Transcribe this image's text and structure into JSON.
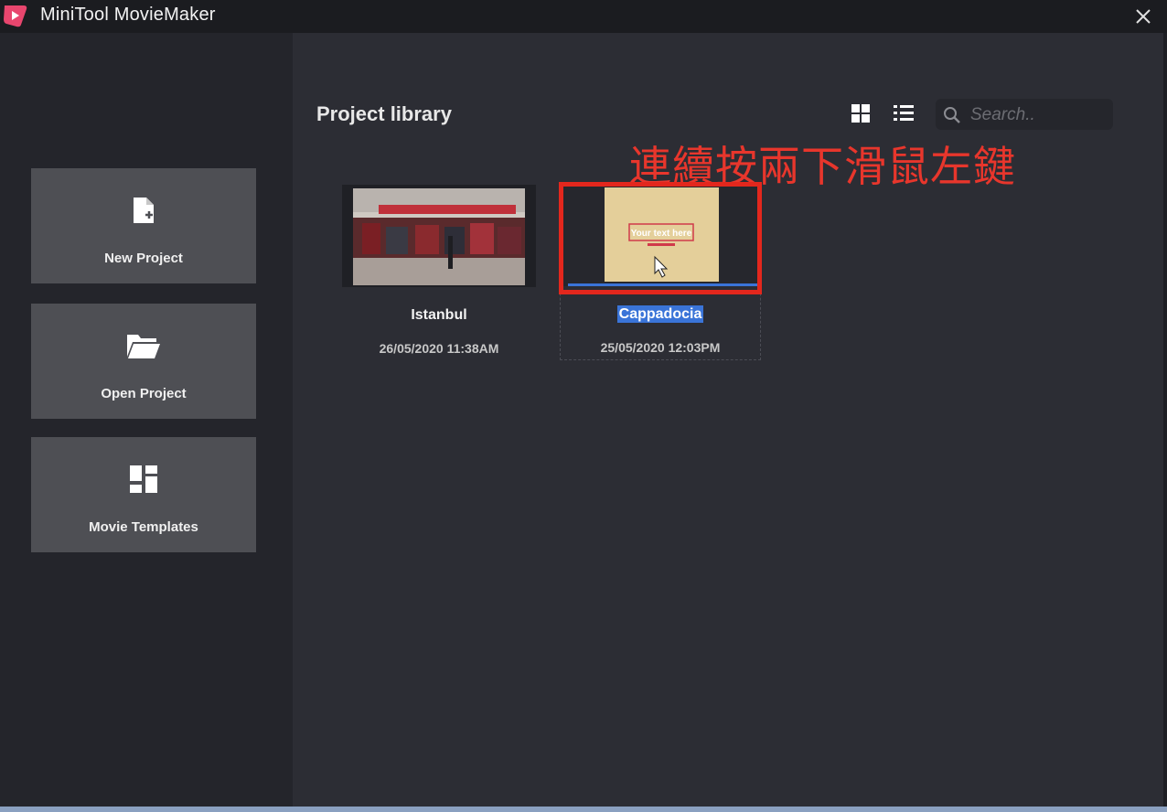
{
  "app": {
    "title": "MiniTool MovieMaker",
    "accent": "#e8466e"
  },
  "sidebar": {
    "items": [
      {
        "label": "New Project",
        "icon": "new-file-icon"
      },
      {
        "label": "Open Project",
        "icon": "folder-icon"
      },
      {
        "label": "Movie Templates",
        "icon": "templates-icon"
      }
    ]
  },
  "library": {
    "title": "Project library",
    "search_placeholder": "Search..",
    "view_icons": [
      "grid-view-icon",
      "list-view-icon"
    ],
    "projects": [
      {
        "name": "Istanbul",
        "date": "26/05/2020  11:38AM",
        "selected": false
      },
      {
        "name": "Cappadocia",
        "date": "25/05/2020  12:03PM",
        "selected": true,
        "thumb_text": "Your text here"
      }
    ]
  },
  "annotation": {
    "text": "連續按兩下滑鼠左鍵",
    "color": "#e3271d"
  },
  "colors": {
    "selection": "#3a74d8",
    "highlight_box": "#e3271d"
  }
}
